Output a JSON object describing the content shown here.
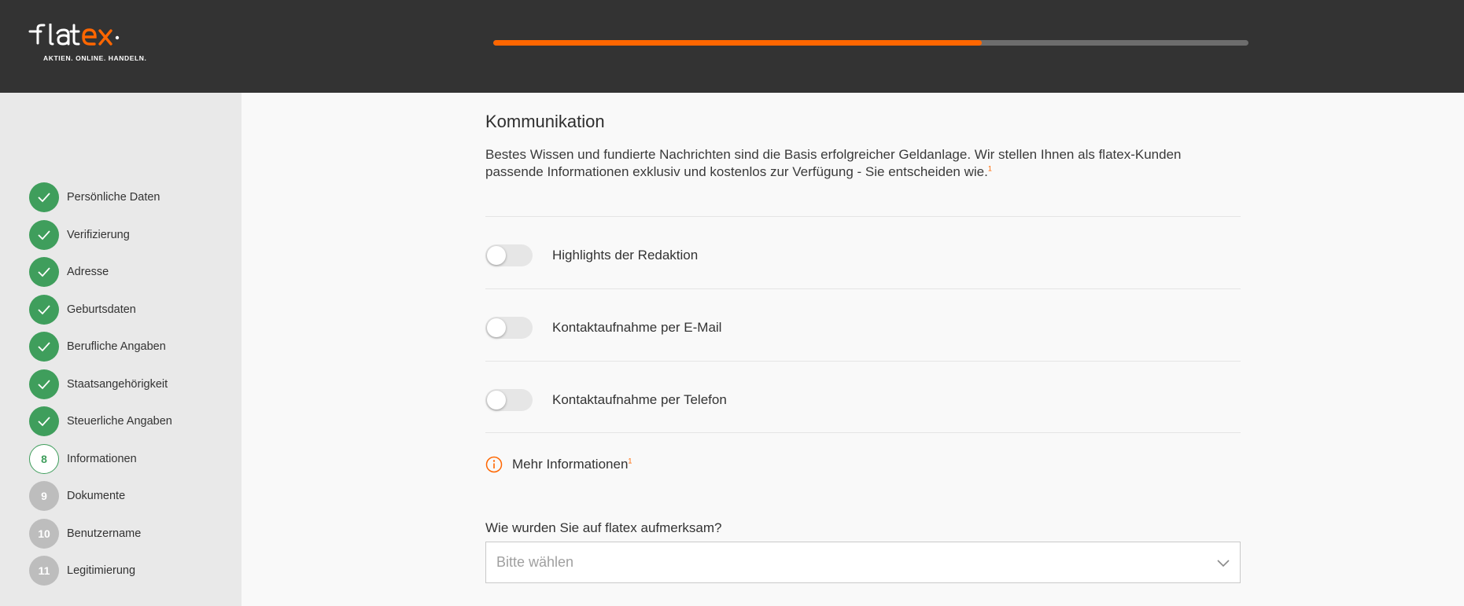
{
  "header": {
    "logo_text": "flatex",
    "logo_tagline": "AKTIEN. ONLINE. HANDELN.",
    "progress": 0.647,
    "colors": {
      "accent": "#ff6600",
      "header_bg": "#333333",
      "success": "#3f9e5c"
    }
  },
  "sidebar": {
    "steps": [
      {
        "label": "Persönliche Daten",
        "state": "done",
        "icon": "check-icon"
      },
      {
        "label": "Verifizierung",
        "state": "done",
        "icon": "check-icon"
      },
      {
        "label": "Adresse",
        "state": "done",
        "icon": "check-icon"
      },
      {
        "label": "Geburtsdaten",
        "state": "done",
        "icon": "check-icon"
      },
      {
        "label": "Berufliche Angaben",
        "state": "done",
        "icon": "check-icon"
      },
      {
        "label": "Staatsangehörigkeit",
        "state": "done",
        "icon": "check-icon"
      },
      {
        "label": "Steuerliche Angaben",
        "state": "done",
        "icon": "check-icon"
      },
      {
        "label": "Informationen",
        "state": "active",
        "number": "8"
      },
      {
        "label": "Dokumente",
        "state": "todo",
        "number": "9"
      },
      {
        "label": "Benutzername",
        "state": "todo",
        "number": "10"
      },
      {
        "label": "Legitimierung",
        "state": "todo",
        "number": "11"
      }
    ]
  },
  "main": {
    "title": "Kommunikation",
    "intro": "Bestes Wissen und fundierte Nachrichten sind die Basis erfolgreicher Geldanlage. Wir stellen Ihnen als flatex-Kunden passende Informationen exklusiv und kostenlos zur Verfügung - Sie entscheiden wie.",
    "footnote_mark": "1",
    "toggles": [
      {
        "label": "Highlights der Redaktion",
        "on": false
      },
      {
        "label": "Kontaktaufnahme per E-Mail",
        "on": false
      },
      {
        "label": "Kontaktaufnahme per Telefon",
        "on": false
      }
    ],
    "more_info": {
      "label": "Mehr Informationen",
      "footnote_mark": "1",
      "icon": "info-icon"
    },
    "source_question": {
      "label": "Wie wurden Sie auf flatex aufmerksam?",
      "placeholder": "Bitte wählen",
      "icon": "chevron-down-icon"
    }
  }
}
